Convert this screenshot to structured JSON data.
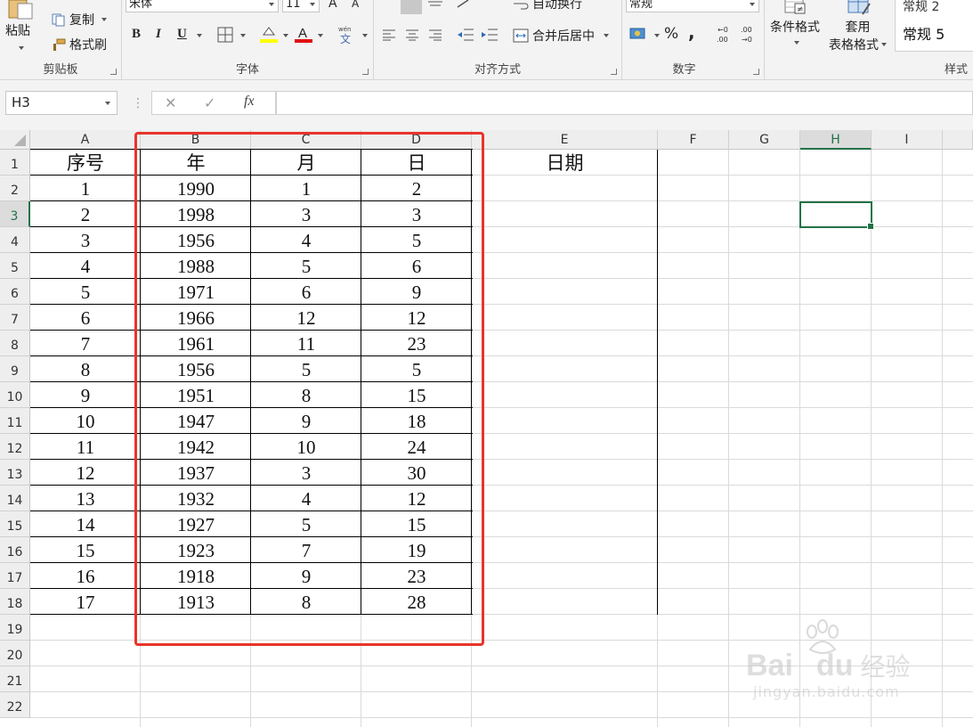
{
  "ribbon": {
    "clipboard": {
      "paste": "粘贴",
      "copy": "复制",
      "format_painter": "格式刷",
      "label": "剪贴板"
    },
    "font": {
      "name": "宋体",
      "size": "11",
      "bold": "B",
      "italic": "I",
      "underline": "U",
      "label": "字体"
    },
    "alignment": {
      "wrap_text": "自动换行",
      "merge_center": "合并后居中",
      "label": "对齐方式"
    },
    "number": {
      "format": "常规",
      "percent": "%",
      "comma": ",",
      "label": "数字"
    },
    "styles": {
      "conditional": "条件格式",
      "table_line1": "套用",
      "table_line2": "表格格式",
      "style1": "常规 2",
      "style2": "常规 5",
      "label": "样式"
    }
  },
  "formula_bar": {
    "name_box": "H3",
    "cancel": "✕",
    "enter": "✓",
    "fx": "fx",
    "content": ""
  },
  "columns": [
    "A",
    "B",
    "C",
    "D",
    "E",
    "F",
    "G",
    "H",
    "I"
  ],
  "rows": [
    "1",
    "2",
    "3",
    "4",
    "5",
    "6",
    "7",
    "8",
    "9",
    "10",
    "11",
    "12",
    "13",
    "14",
    "15",
    "16",
    "17",
    "18",
    "19",
    "20",
    "21",
    "22"
  ],
  "table": {
    "headers": [
      "序号",
      "年",
      "月",
      "日",
      "日期"
    ],
    "data": [
      [
        "1",
        "1990",
        "1",
        "2"
      ],
      [
        "2",
        "1998",
        "3",
        "3"
      ],
      [
        "3",
        "1956",
        "4",
        "5"
      ],
      [
        "4",
        "1988",
        "5",
        "6"
      ],
      [
        "5",
        "1971",
        "6",
        "9"
      ],
      [
        "6",
        "1966",
        "12",
        "12"
      ],
      [
        "7",
        "1961",
        "11",
        "23"
      ],
      [
        "8",
        "1956",
        "5",
        "5"
      ],
      [
        "9",
        "1951",
        "8",
        "15"
      ],
      [
        "10",
        "1947",
        "9",
        "18"
      ],
      [
        "11",
        "1942",
        "10",
        "24"
      ],
      [
        "12",
        "1937",
        "3",
        "30"
      ],
      [
        "13",
        "1932",
        "4",
        "12"
      ],
      [
        "14",
        "1927",
        "5",
        "15"
      ],
      [
        "15",
        "1923",
        "7",
        "19"
      ],
      [
        "16",
        "1918",
        "9",
        "23"
      ],
      [
        "17",
        "1913",
        "8",
        "28"
      ]
    ]
  },
  "selected_cell": "H3",
  "watermark": {
    "brand_a": "Bai",
    "brand_b": "du",
    "brand_cn": "经验",
    "url": "jingyan.baidu.com"
  },
  "colors": {
    "accent": "#217346",
    "highlight": "#e8342b"
  }
}
